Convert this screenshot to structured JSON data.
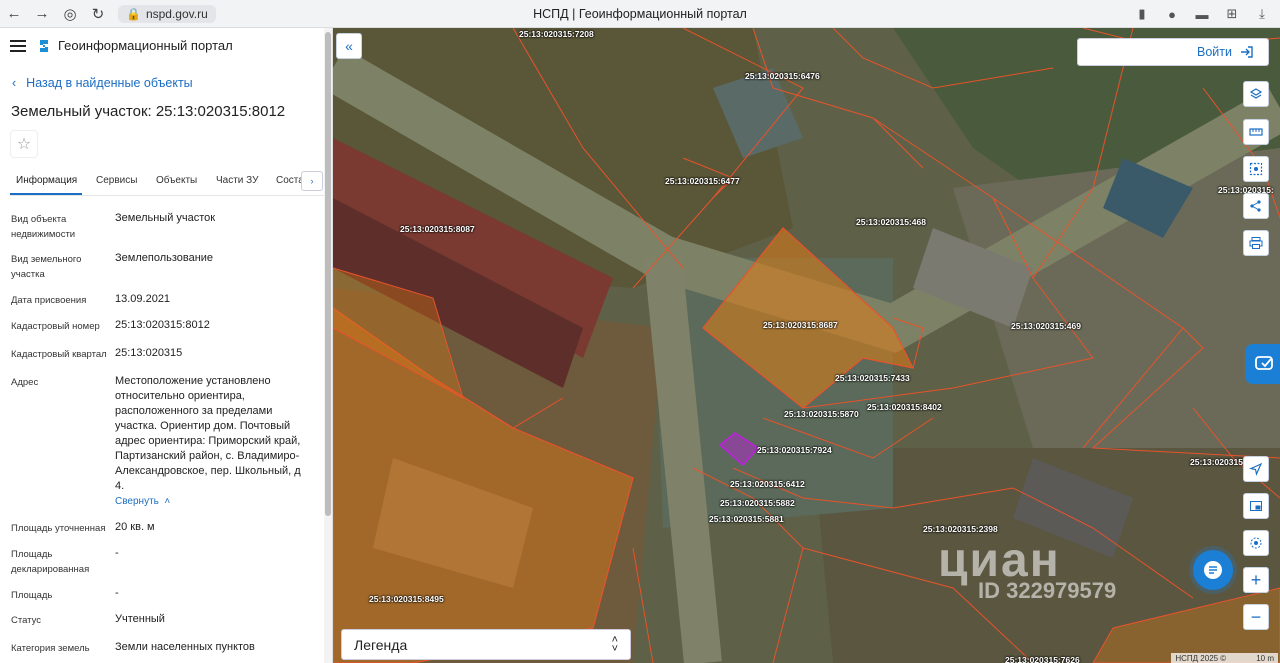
{
  "browser": {
    "url": "nspd.gov.ru",
    "title": "НСПД | Геоинформационный портал"
  },
  "sidebar": {
    "portal_name": "Геоинформационный портал",
    "back_link": "Назад в найденные объекты",
    "object_title": "Земельный участок: 25:13:020315:8012",
    "tabs": [
      {
        "label": "Информация",
        "active": true
      },
      {
        "label": "Сервисы"
      },
      {
        "label": "Объекты"
      },
      {
        "label": "Части ЗУ"
      },
      {
        "label": "Соста"
      }
    ],
    "properties": [
      {
        "label": "Вид объекта недвижимости",
        "value": "Земельный участок"
      },
      {
        "label": "Вид земельного участка",
        "value": "Землепользование"
      },
      {
        "label": "Дата присвоения",
        "value": "13.09.2021"
      },
      {
        "label": "Кадастровый номер",
        "value": "25:13:020315:8012"
      },
      {
        "label": "Кадастровый квартал",
        "value": "25:13:020315"
      },
      {
        "label": "Адрес",
        "value": "Местоположение установлено относительно ориентира, расположенного за пределами участка. Ориентир дом. Почтовый адрес ориентира: Приморский край, Партизанский район, с. Владимиро-Александровское, пер. Школьный, д 4."
      },
      {
        "label": "Площадь уточненная",
        "value": "20 кв. м"
      },
      {
        "label": "Площадь декларированная",
        "value": "-"
      },
      {
        "label": "Площадь",
        "value": "-"
      },
      {
        "label": "Статус",
        "value": "Учтенный"
      },
      {
        "label": "Категория земель",
        "value": "Земли населенных пунктов"
      }
    ],
    "collapse_link": "Свернуть"
  },
  "map": {
    "login_label": "Войти",
    "legend_label": "Легенда",
    "watermark": "циан",
    "watermark_id": "ID 322979579",
    "attribution": "НСПД 2025 ©",
    "scale": "10 m",
    "parcel_labels": [
      "25:13:020315:7208",
      "25:13:020315:6476",
      "25:13:020315:6477",
      "25:13:020315:8087",
      "25:13:020315:468",
      "25:13:020315:8687",
      "25:13:020315:469",
      "25:13:020315:7433",
      "25:13:020315:5870",
      "25:13:020315:8402",
      "25:13:020315:7924",
      "25:13:020315:6412",
      "25:13:020315:5882",
      "25:13:020315:5881",
      "25:13:020315:2398",
      "25:13:020315:8495",
      "25:13:020315:",
      "25:13:020315:",
      "25:13:020315:7626"
    ]
  },
  "colors": {
    "accent": "#1c6ec4",
    "parcel_outline": "#e8532a",
    "parcel_fill": "#e07b14",
    "selected_parcel": "#c020e0"
  }
}
